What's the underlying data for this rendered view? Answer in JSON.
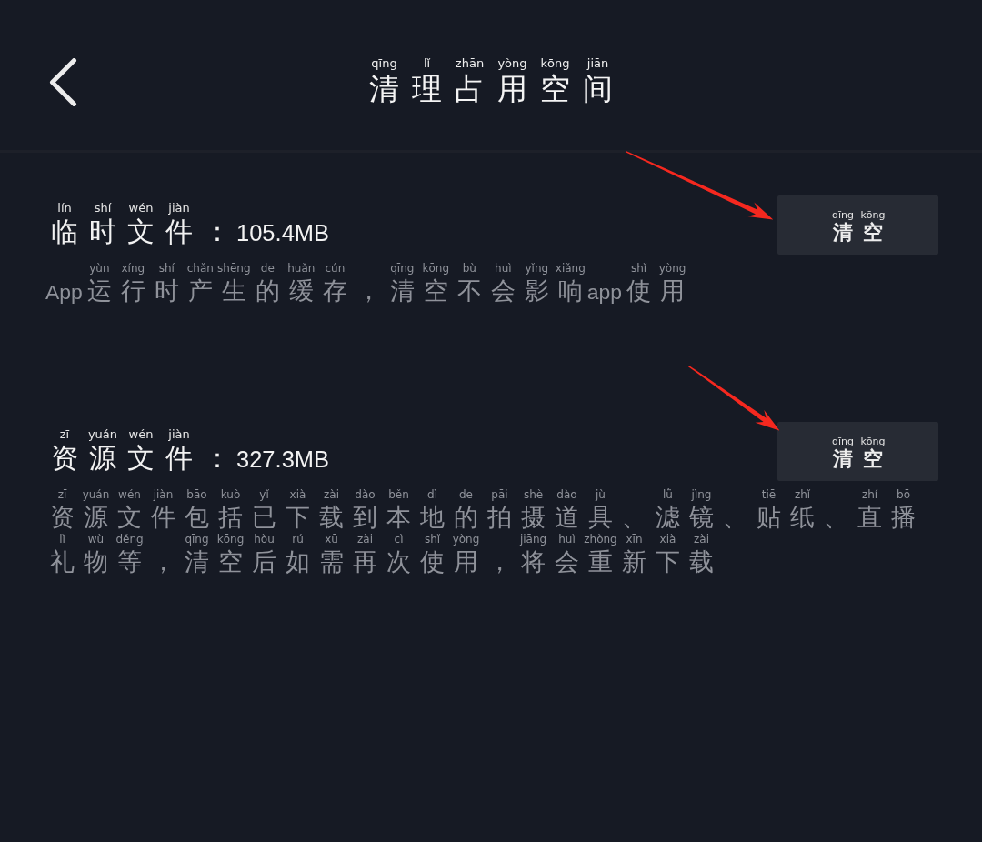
{
  "header": {
    "title": {
      "text": "清理占用空间",
      "pinyin": "qīng lǐ zhān yòng kōng jiān"
    }
  },
  "sections": [
    {
      "title": {
        "text": "临时文件：105.4MB",
        "pinyin": "lín shí wén jiàn"
      },
      "button": {
        "text": "清空",
        "pinyin": "qīng kōng"
      },
      "marked_by_arrow": true,
      "description_lines": [
        {
          "text": "App运行时产生的缓存，清空不会影响app使用",
          "pinyin": "yùn xíng shí chǎn shēng de huǎn cún qīng kōng bù huì yǐng xiǎng shǐ yòng"
        }
      ]
    },
    {
      "title": {
        "text": "资源文件：327.3MB",
        "pinyin": "zī yuán wén jiàn"
      },
      "button": {
        "text": "清空",
        "pinyin": "qīng kōng"
      },
      "marked_by_arrow": true,
      "description_lines": [
        {
          "text": "资源文件包括已下载到本地的拍摄道具、滤镜、贴纸、直播",
          "pinyin": "zī yuán wén jiàn bāo kuò yǐ xià zài dào běn dì de pāi shè dào jù lǜ jìng tiē zhǐ zhí bō"
        },
        {
          "text": "礼物等，清空后如需再次使用，将会重新下载",
          "pinyin": "lǐ wù děng qīng kōng hòu rú xū zài cì shǐ yòng jiāng huì zhòng xīn xià zài"
        }
      ]
    }
  ]
}
